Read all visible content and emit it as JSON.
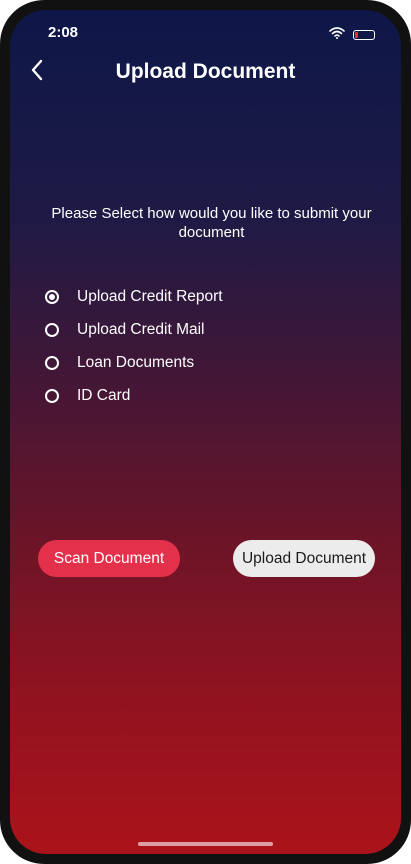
{
  "status_bar": {
    "time": "2:08"
  },
  "header": {
    "title": "Upload Document",
    "back_icon": "chevron-left-icon"
  },
  "prompt": {
    "text": "Please Select how would you like to submit your document"
  },
  "options": [
    {
      "label": "Upload Credit Report",
      "selected": true
    },
    {
      "label": "Upload Credit Mail",
      "selected": false
    },
    {
      "label": "Loan Documents",
      "selected": false
    },
    {
      "label": "ID Card",
      "selected": false
    }
  ],
  "actions": {
    "scan_label": "Scan Document",
    "upload_label": "Upload Document"
  },
  "colors": {
    "gradient_top": "#0d1748",
    "gradient_bottom": "#ab131a",
    "scan_button": "#e3304b",
    "upload_button": "#ececec",
    "battery_level": "#ff2a2a"
  }
}
